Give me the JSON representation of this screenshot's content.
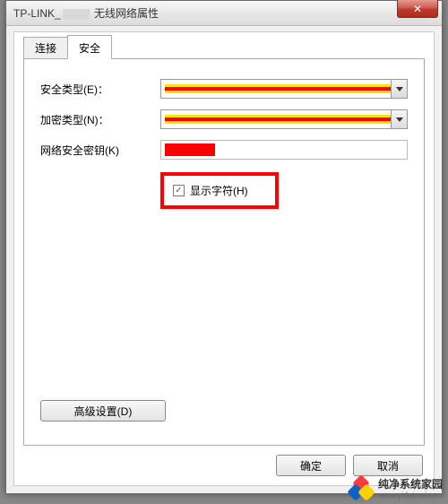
{
  "window": {
    "title_prefix": "TP-LINK_",
    "title_suffix": " 无线网络属性",
    "close_glyph": "✕"
  },
  "tabs": {
    "connect": "连接",
    "security": "安全"
  },
  "form": {
    "security_type_label": "安全类型(E)：",
    "encryption_type_label": "加密类型(N)：",
    "network_key_label": "网络安全密钥(K)",
    "show_chars_label": "显示字符(H)",
    "show_chars_checked": "✓"
  },
  "buttons": {
    "advanced": "高级设置(D)",
    "ok": "确定",
    "cancel": "取消"
  },
  "watermark": {
    "name": "纯净系统家园",
    "url": "www.yidaimei.com"
  }
}
